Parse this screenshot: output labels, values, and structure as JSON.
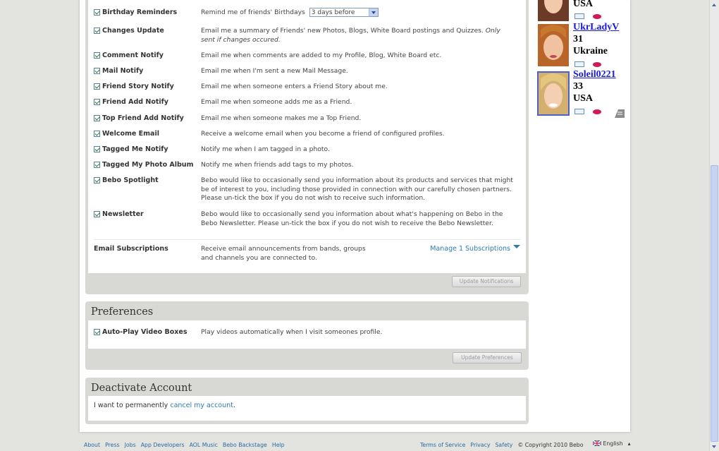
{
  "notifications": {
    "rows": [
      {
        "label": "Birthday Reminders",
        "desc_pre": "Remind me of friends' Birthdays",
        "select": "3 days before"
      },
      {
        "label": "Changes Update",
        "desc": "Email me a summary of Friends' new Photos, Blogs, White Board postings and Quizzes.",
        "desc_note": "Only sent if changes occured."
      },
      {
        "label": "Comment Notify",
        "desc": "Email me when comments are added to my Profile, Blog, White Board etc."
      },
      {
        "label": "Mail Notify",
        "desc": "Email me when I'm sent a new Mail Message."
      },
      {
        "label": "Friend Story Notify",
        "desc": "Email me when someone enters a Friend Story about me."
      },
      {
        "label": "Friend Add Notify",
        "desc": "Email me when someone adds me as a Friend."
      },
      {
        "label": "Top Friend Add Notify",
        "desc": "Email me when someone makes me a Top Friend."
      },
      {
        "label": "Welcome Email",
        "desc": "Receive a welcome email when you become a friend of configured profiles."
      },
      {
        "label": "Tagged Me Notify",
        "desc": "Notify me when I am tagged in a photo."
      },
      {
        "label": "Tagged My Photo Album",
        "desc": "Notify me when friends add tags to my photos."
      },
      {
        "label": "Bebo Spotlight",
        "desc": "Bebo would like to occasionally send you information about its products and services that might be of interest to you, including those provided in connection with our carefully chosen partners. Please un-tick the box if you do not wish to receive such information."
      },
      {
        "label": "Newsletter",
        "desc": "Bebo would like to occasionally send you information about what's happening on Bebo in the Bebo Newsletter. Please un-tick the box if you do not wish to receive the Bebo Newsletter."
      }
    ],
    "subscriptions": {
      "label": "Email Subscriptions",
      "desc": "Receive email announcements from bands, groups and channels you are connected to.",
      "manage": "Manage 1 Subscriptions"
    },
    "update_button": "Update Notifications"
  },
  "preferences": {
    "title": "Preferences",
    "autoplay_label": "Auto-Play Video Boxes",
    "autoplay_desc": "Play videos automatically when I visit someones profile.",
    "update_button": "Update Preferences"
  },
  "deactivate": {
    "title": "Deactivate Account",
    "text": "I want to permanently",
    "link": "cancel my account",
    "end": "."
  },
  "friends": [
    {
      "name": "",
      "age": "",
      "country": "USA"
    },
    {
      "name": "UkrLadyV",
      "age": "31",
      "country": "Ukraine"
    },
    {
      "name": "Soleil0221",
      "age": "33",
      "country": "USA"
    }
  ],
  "footer": {
    "left": [
      "About",
      "Press",
      "Jobs",
      "App Developers",
      "AOL Music",
      "Bebo Backstage",
      "Help"
    ],
    "right": [
      "Terms of Service",
      "Privacy",
      "Safety"
    ],
    "copyright": "© Copyright 2010 Bebo",
    "language": "English"
  }
}
